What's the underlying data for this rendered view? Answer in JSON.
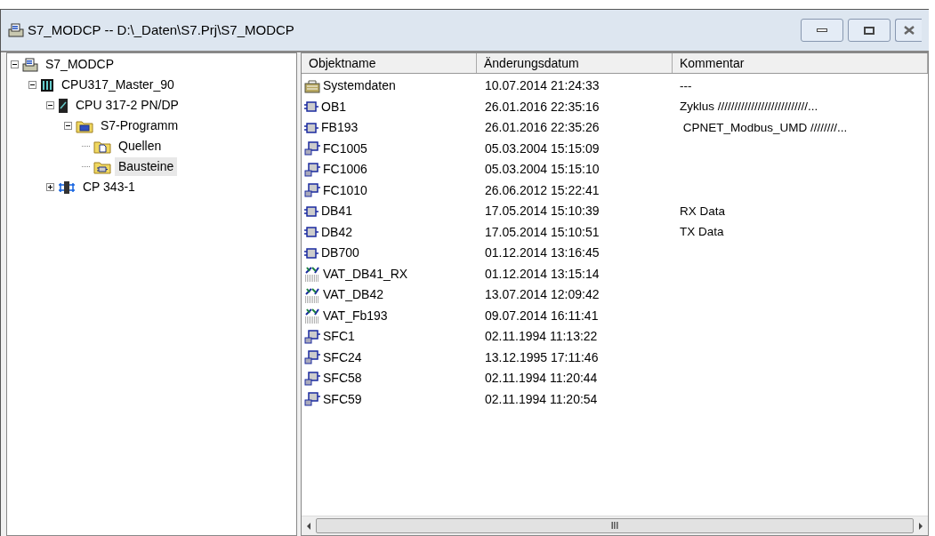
{
  "window": {
    "title": "S7_MODCP -- D:\\_Daten\\S7.Prj\\S7_MODCP"
  },
  "tree": [
    {
      "label": "S7_MODCP",
      "kind": "project",
      "expanded": true,
      "selected": false,
      "children": [
        {
          "label": "CPU317_Master_90",
          "kind": "station",
          "expanded": true,
          "selected": false,
          "children": [
            {
              "label": "CPU 317-2 PN/DP",
              "kind": "cpu",
              "expanded": true,
              "selected": false,
              "children": [
                {
                  "label": "S7-Programm",
                  "kind": "program",
                  "expanded": true,
                  "selected": false,
                  "children": [
                    {
                      "label": "Quellen",
                      "kind": "sources",
                      "selected": false
                    },
                    {
                      "label": "Bausteine",
                      "kind": "blocks",
                      "selected": true
                    }
                  ]
                }
              ]
            },
            {
              "label": "CP 343-1",
              "kind": "cp",
              "expanded": false,
              "selected": false
            }
          ]
        }
      ]
    }
  ],
  "table": {
    "columns": [
      "Objektname",
      "Änderungsdatum",
      "Kommentar"
    ],
    "rows": [
      {
        "kind": "system",
        "name": "Systemdaten",
        "date": "10.07.2014 21:24:33",
        "comment": "---"
      },
      {
        "kind": "block",
        "name": "OB1",
        "date": "26.01.2016 22:35:16",
        "comment": "Zyklus ///////////////////////////..."
      },
      {
        "kind": "block",
        "name": "FB193",
        "date": "26.01.2016 22:35:26",
        "comment": " CPNET_Modbus_UMD ////////..."
      },
      {
        "kind": "function",
        "name": "FC1005",
        "date": "05.03.2004 15:15:09"
      },
      {
        "kind": "function",
        "name": "FC1006",
        "date": "05.03.2004 15:15:10"
      },
      {
        "kind": "function",
        "name": "FC1010",
        "date": "26.06.2012 15:22:41"
      },
      {
        "kind": "block",
        "name": "DB41",
        "date": "17.05.2014 15:10:39",
        "comment": "RX Data"
      },
      {
        "kind": "block",
        "name": "DB42",
        "date": "17.05.2014 15:10:51",
        "comment": "TX Data"
      },
      {
        "kind": "block",
        "name": "DB700",
        "date": "01.12.2014 13:16:45"
      },
      {
        "kind": "table",
        "name": "VAT_DB41_RX",
        "date": "01.12.2014 13:15:14"
      },
      {
        "kind": "table",
        "name": "VAT_DB42",
        "date": "13.07.2014 12:09:42"
      },
      {
        "kind": "table",
        "name": "VAT_Fb193",
        "date": "09.07.2014 16:11:41"
      },
      {
        "kind": "function",
        "name": "SFC1",
        "date": "02.11.1994 11:13:22"
      },
      {
        "kind": "function",
        "name": "SFC24",
        "date": "13.12.1995 17:11:46"
      },
      {
        "kind": "function",
        "name": "SFC58",
        "date": "02.11.1994 11:20:44"
      },
      {
        "kind": "function",
        "name": "SFC59",
        "date": "02.11.1994 11:20:54"
      }
    ]
  },
  "scrollbar": {
    "thumb": "III"
  }
}
